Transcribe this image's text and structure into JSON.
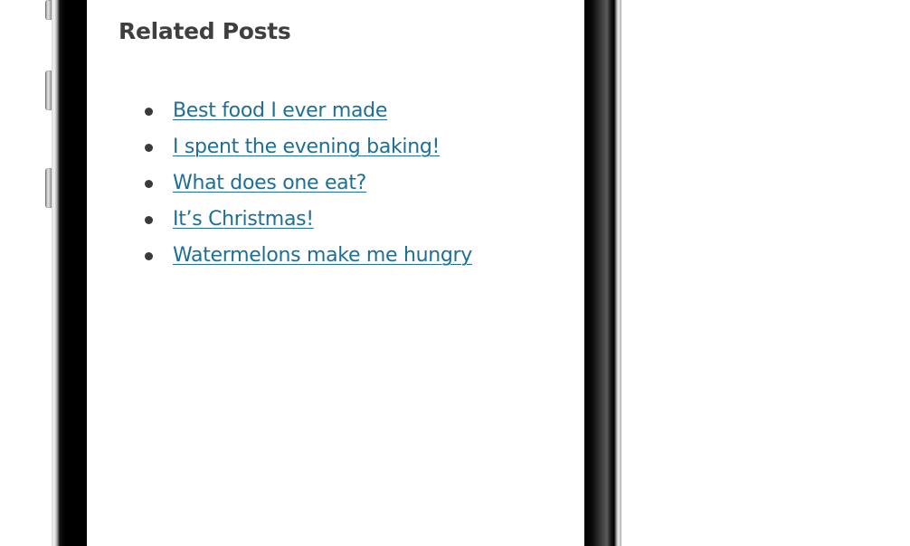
{
  "related_posts": {
    "heading": "Related Posts",
    "items": [
      {
        "label": "Best food I ever made"
      },
      {
        "label": "I spent the evening baking!"
      },
      {
        "label": "What does one eat?"
      },
      {
        "label": "It’s Christmas!"
      },
      {
        "label": "Watermelons make me hungry"
      }
    ]
  },
  "colors": {
    "link": "#1e6f93",
    "heading": "#3f3f3f",
    "bullet": "#3a3a3a",
    "phone_frame": "#000000",
    "background": "#ffffff"
  }
}
